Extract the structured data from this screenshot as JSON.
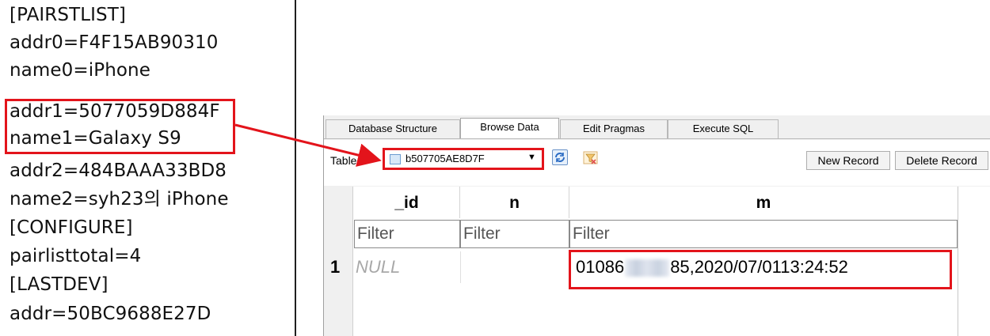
{
  "text_file": {
    "lines": [
      "[PAIRSTLIST]",
      "addr0=F4F15AB90310",
      "name0=iPhone",
      "addr1=5077059D884F",
      "name1=Galaxy S9",
      "addr2=484BAAA33BD8",
      "name2=syh23의 iPhone",
      "[CONFIGURE]",
      "pairlisttotal=4",
      "[LASTDEV]",
      "addr=50BC9688E27D"
    ]
  },
  "db_browser": {
    "tabs": [
      {
        "label": "Database Structure"
      },
      {
        "label": "Browse Data",
        "active": true
      },
      {
        "label": "Edit Pragmas"
      },
      {
        "label": "Execute SQL"
      }
    ],
    "table_label": "Table:",
    "selected_table": "b507705AE8D7F",
    "new_record_label": "New Record",
    "delete_record_label": "Delete Record",
    "columns": [
      "_id",
      "n",
      "m"
    ],
    "filter_placeholder": "Filter",
    "rows": [
      {
        "row_number": "1",
        "_id": "NULL",
        "n": "",
        "m_prefix": "01086",
        "m_suffix": "85,2020/07/0113:24:52"
      }
    ]
  },
  "colors": {
    "highlight": "#e3141b"
  }
}
